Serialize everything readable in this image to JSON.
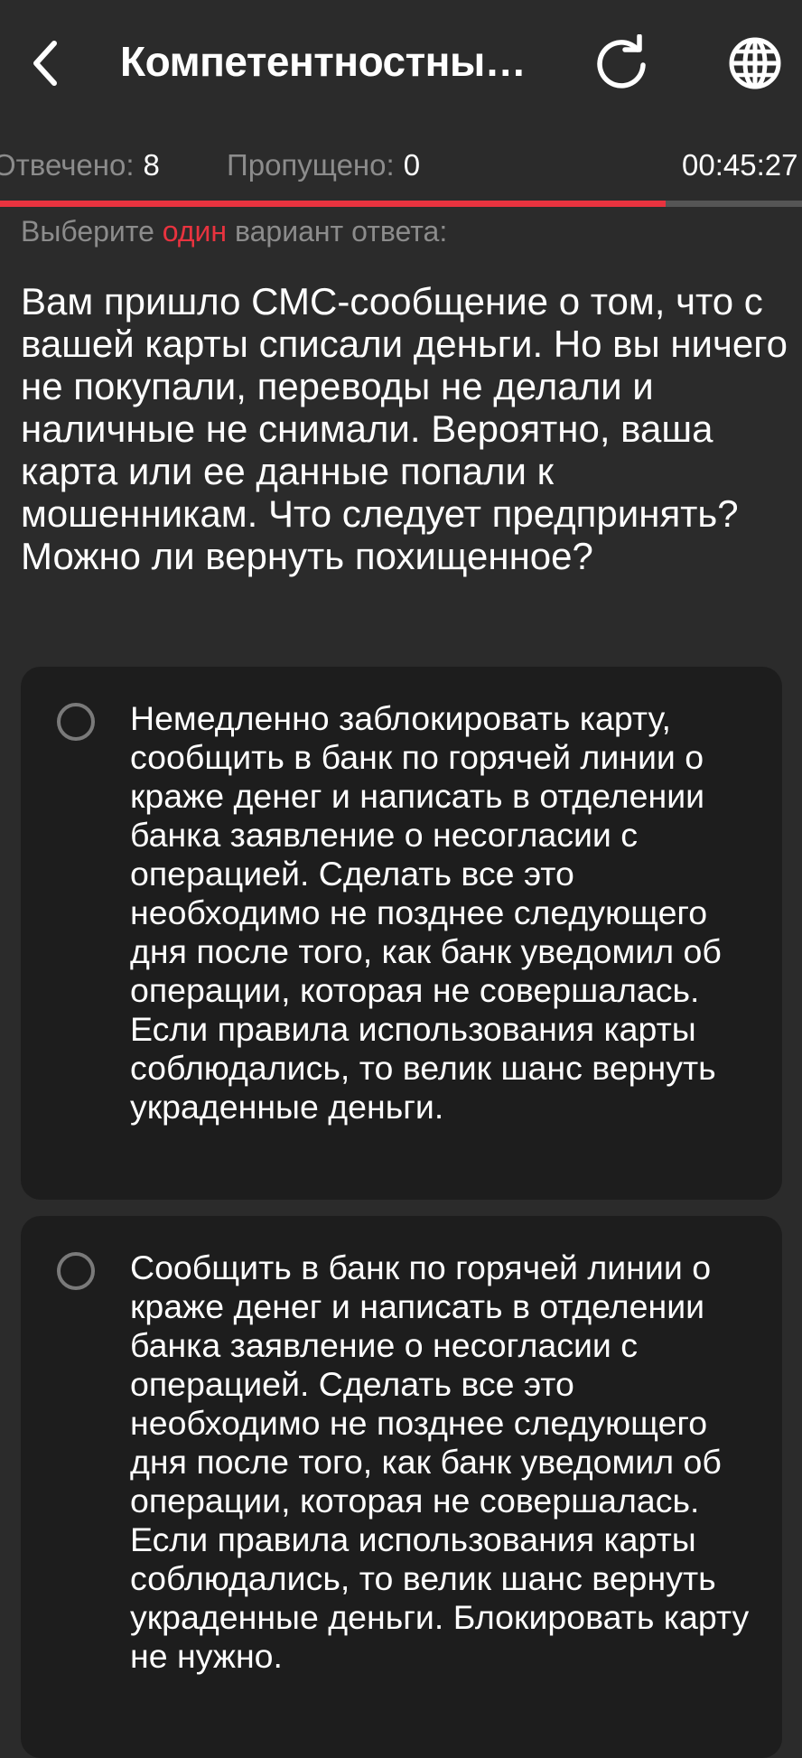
{
  "header": {
    "title": "Компетентностны…",
    "back_icon": "chevron-left-icon",
    "refresh_icon": "refresh-icon",
    "language_icon": "globe-icon"
  },
  "stats": {
    "answered_label": "Отвечено:",
    "answered_value": "8",
    "skipped_label": "Пропущено:",
    "skipped_value": "0",
    "timer": "00:45:27"
  },
  "progress": {
    "fraction": 0.83,
    "fill_color": "#e8333f"
  },
  "hint": {
    "prefix": "Выберите",
    "accent": "один",
    "suffix": "вариант ответа:"
  },
  "question": "Вам пришло СМС-сообщение о том, что с вашей карты списали деньги. Но вы ничего не покупали, переводы не делали и наличные не снимали. Вероятно, ваша карта или ее данные попали к мошенникам. Что следует предпринять? Можно ли вернуть похищенное?",
  "options": [
    {
      "text": "Немедленно заблокировать карту, сообщить в банк по горячей линии о краже денег и написать в отделении банка заявление о несогласии с операцией. Сделать все это необходимо не позднее следующего дня после того, как банк уведомил об операции, которая не совершалась. Если правила использования карты соблюдались, то велик шанс вернуть украденные деньги.",
      "selected": false
    },
    {
      "text": "Сообщить в банк по горячей линии о краже денег и написать в отделении банка заявление о несогласии с операцией. Сделать все это необходимо не позднее следующего дня после того, как банк уведомил об операции, которая не совершалась. Если правила использования карты соблюдались, то велик шанс вернуть украденные деньги. Блокировать карту не нужно.",
      "selected": false
    }
  ],
  "colors": {
    "background": "#2b2b2b",
    "card": "#1d1d1d",
    "accent": "#e8333f",
    "muted_text": "#8c8c8c"
  }
}
